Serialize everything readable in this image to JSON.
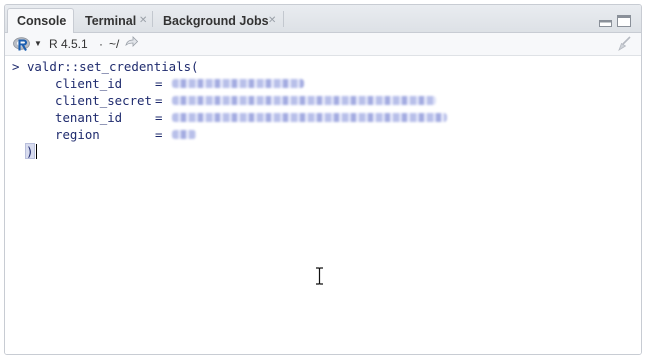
{
  "tabs": [
    {
      "label": "Console",
      "active": true
    },
    {
      "label": "Terminal",
      "active": false
    },
    {
      "label": "Background Jobs",
      "active": false
    }
  ],
  "toolbar": {
    "r_version": "R 4.5.1",
    "separator": "·",
    "working_dir": "~/"
  },
  "console": {
    "prompt": ">",
    "call": "valdr::set_credentials(",
    "args": [
      {
        "name": "client_id",
        "eq": "="
      },
      {
        "name": "client_secret",
        "eq": "="
      },
      {
        "name": "tenant_id",
        "eq": "="
      },
      {
        "name": "region",
        "eq": "="
      }
    ],
    "closing": ")"
  },
  "icons": [
    "r-logo-icon",
    "dropdown-arrow-icon",
    "go-to-directory-icon",
    "close-icon",
    "minimize-icon",
    "maximize-icon",
    "clear-console-icon",
    "text-cursor-icon"
  ],
  "colors": {
    "code_text": "#1f2b6e",
    "pane_border": "#c8ccd3",
    "tab_bar": "#dde1e6",
    "redaction": "#7e8bd8"
  }
}
